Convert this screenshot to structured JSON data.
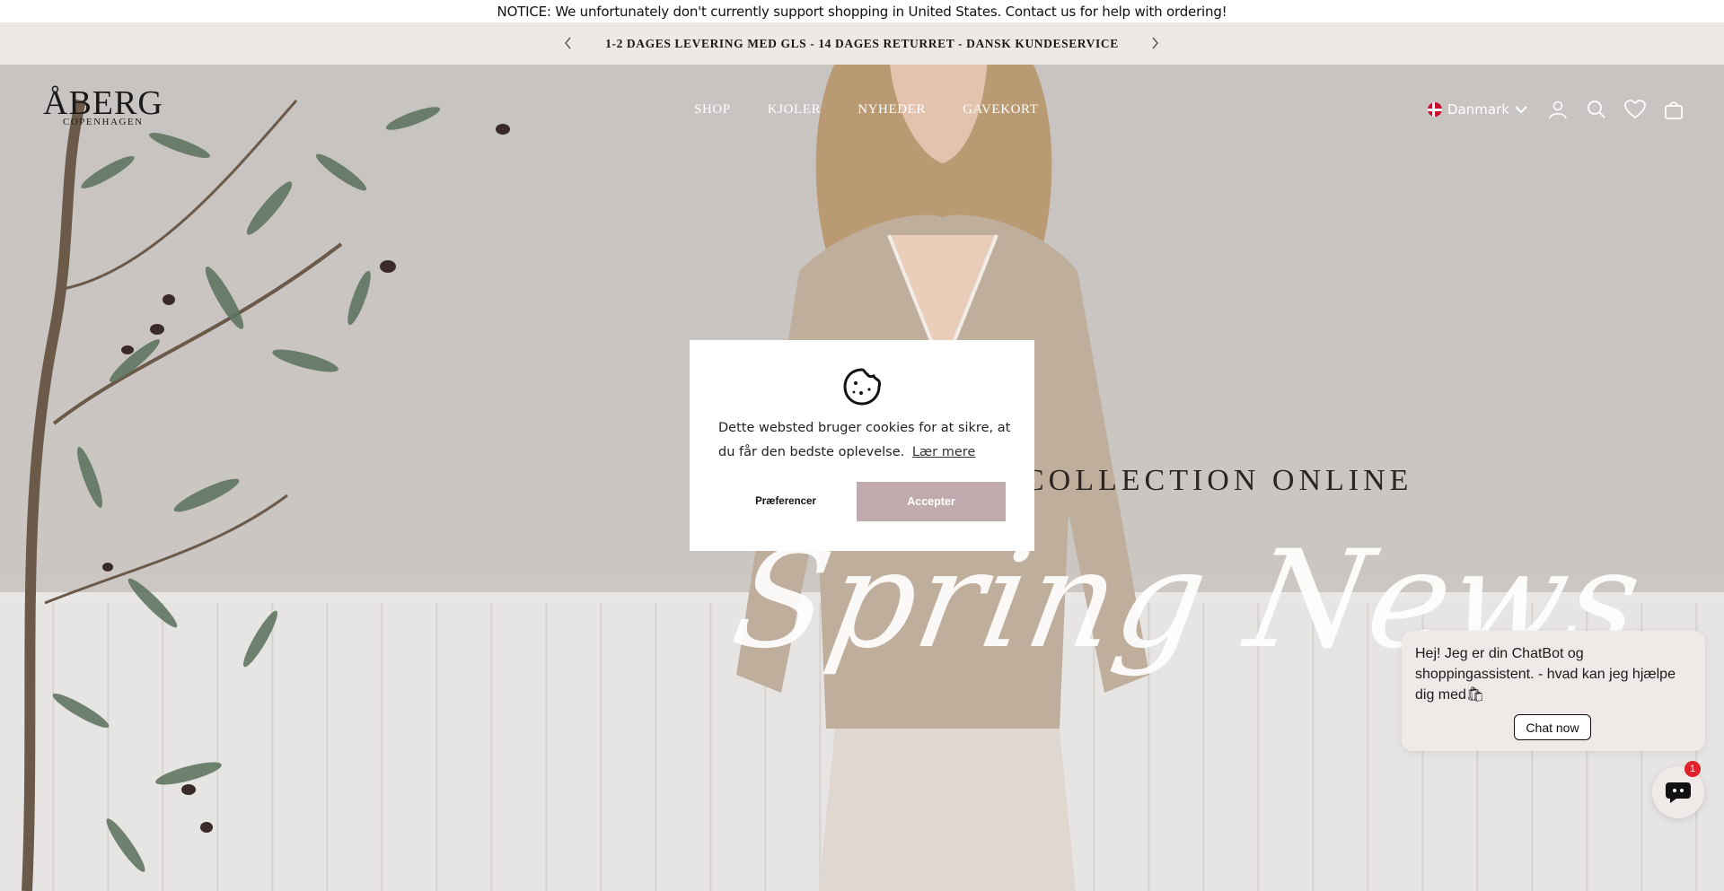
{
  "notice": {
    "text": "NOTICE: We unfortunately don't currently support shopping in United States. Contact us for help with ordering!"
  },
  "announcement": {
    "text": "1-2 DAGES LEVERING MED GLS - 14 DAGES RETURRET - DANSK KUNDESERVICE",
    "prev_icon": "chevron-left-icon",
    "next_icon": "chevron-right-icon"
  },
  "header": {
    "logo": {
      "line1": "ÅBERG",
      "line2": "COPENHAGEN"
    },
    "nav": [
      "SHOP",
      "KJOLER",
      "NYHEDER",
      "GAVEKORT"
    ],
    "country": "Danmark",
    "icons": [
      "account-icon",
      "search-icon",
      "wishlist-heart-icon",
      "cart-bag-icon"
    ]
  },
  "hero": {
    "collection_text": "COLLECTION ONLINE",
    "script_text": "Spring News"
  },
  "cookie": {
    "text": "Dette websted bruger cookies for at sikre, at du får den bedste oplevelse.",
    "link": "Lær mere",
    "preferences": "Præferencer",
    "accept": "Accepter",
    "accept_color": "#c1aaae"
  },
  "chat": {
    "message": "Hej! Jeg er din ChatBot og shoppingassistent. - hvad kan jeg hjælpe dig med🛍",
    "button": "Chat now",
    "badge": "1"
  }
}
